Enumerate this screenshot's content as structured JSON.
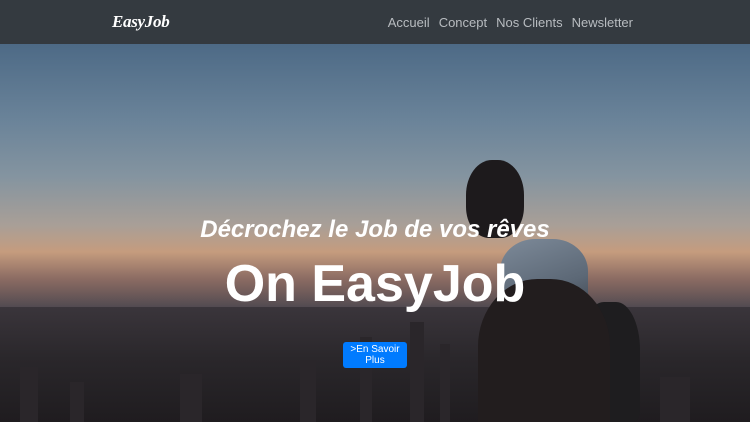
{
  "navbar": {
    "brand": "EasyJob",
    "links": [
      "Accueil",
      "Concept",
      "Nos Clients",
      "Newsletter"
    ]
  },
  "hero": {
    "subtitle": "Décrochez le Job de vos rêves",
    "title": "On EasyJob",
    "cta_label": ">En Savoir Plus"
  },
  "colors": {
    "navbar_bg": "#343a40",
    "cta_bg": "#007bff",
    "text": "#ffffff"
  }
}
